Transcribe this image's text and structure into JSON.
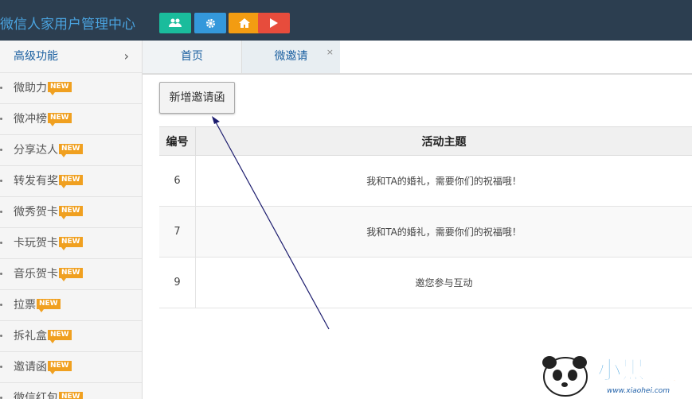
{
  "header": {
    "brand": "微信人家用户管理中心",
    "quick_buttons": [
      {
        "name": "users-icon",
        "color": "#1abc9c"
      },
      {
        "name": "gear-icon",
        "color": "#3498db"
      },
      {
        "name": "home-icon",
        "color": "#f39c12"
      },
      {
        "name": "play-icon",
        "color": "#e74c3c"
      }
    ]
  },
  "sidebar": {
    "head_label": "高级功能",
    "new_badge": "NEW",
    "items": [
      {
        "label": "微助力"
      },
      {
        "label": "微冲榜"
      },
      {
        "label": "分享达人"
      },
      {
        "label": "转发有奖"
      },
      {
        "label": "微秀贺卡"
      },
      {
        "label": "卡玩贺卡"
      },
      {
        "label": "音乐贺卡"
      },
      {
        "label": "拉票"
      },
      {
        "label": "拆礼盒"
      },
      {
        "label": "邀请函"
      },
      {
        "label": "微信红包"
      }
    ]
  },
  "tabs": {
    "home_label": "首页",
    "invite_label": "微邀请",
    "close_glyph": "×"
  },
  "toolbar": {
    "add_label": "新增邀请函"
  },
  "table": {
    "headers": {
      "num": "编号",
      "topic": "活动主题"
    },
    "rows": [
      {
        "num": "6",
        "topic": "我和TA的婚礼，需要你们的祝福哦！"
      },
      {
        "num": "7",
        "topic": "我和TA的婚礼，需要你们的祝福哦！"
      },
      {
        "num": "9",
        "topic": "邀您参与互动"
      }
    ]
  },
  "watermark": {
    "logo_text": "小黑游戏",
    "url": "www.xiaohei.com"
  }
}
